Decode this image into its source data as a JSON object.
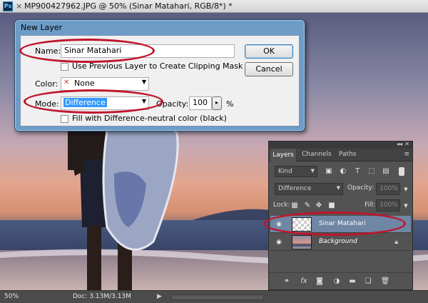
{
  "window": {
    "title": "MP900427962.JPG @ 50% (Sinar Matahari, RGB/8*) *",
    "app_icon": "Ps",
    "close_glyph": "×"
  },
  "status": {
    "zoom": "50%",
    "doc": "Doc: 3.13M/3.13M",
    "arrow": "▶"
  },
  "dialog": {
    "title": "New Layer",
    "name_label": "Name:",
    "name_value": "Sinar Matahari",
    "clipping_label": "Use Previous Layer to Create Clipping Mask",
    "color_label": "Color:",
    "color_value": "None",
    "color_x": "✕",
    "mode_label": "Mode:",
    "mode_value": "Difference",
    "opacity_label": "Opacity:",
    "opacity_value": "100",
    "opacity_unit": "%",
    "fill_label": "Fill with Difference-neutral color (black)",
    "ok_label": "OK",
    "cancel_label": "Cancel",
    "arrow": "▼",
    "stepper": "▸"
  },
  "layers_panel": {
    "collapse_glyph": "◂◂",
    "close_glyph": "✕",
    "menu_glyph": "≡",
    "tabs": [
      "Layers",
      "Channels",
      "Paths"
    ],
    "kind_label": "Kind",
    "blend_mode": "Difference",
    "opacity_label": "Opacity:",
    "opacity_value": "100%",
    "lock_label": "Lock:",
    "fill_label": "Fill:",
    "fill_value": "100%",
    "layers": [
      {
        "name": "Sinar Matahari",
        "selected": true
      },
      {
        "name": "Background",
        "selected": false
      }
    ],
    "lock_glyph": "🔒",
    "footer_fx": "fx"
  },
  "colors": {
    "accent_ring": "#c0152b",
    "selection": "#3399ff",
    "panel": "#535353"
  }
}
